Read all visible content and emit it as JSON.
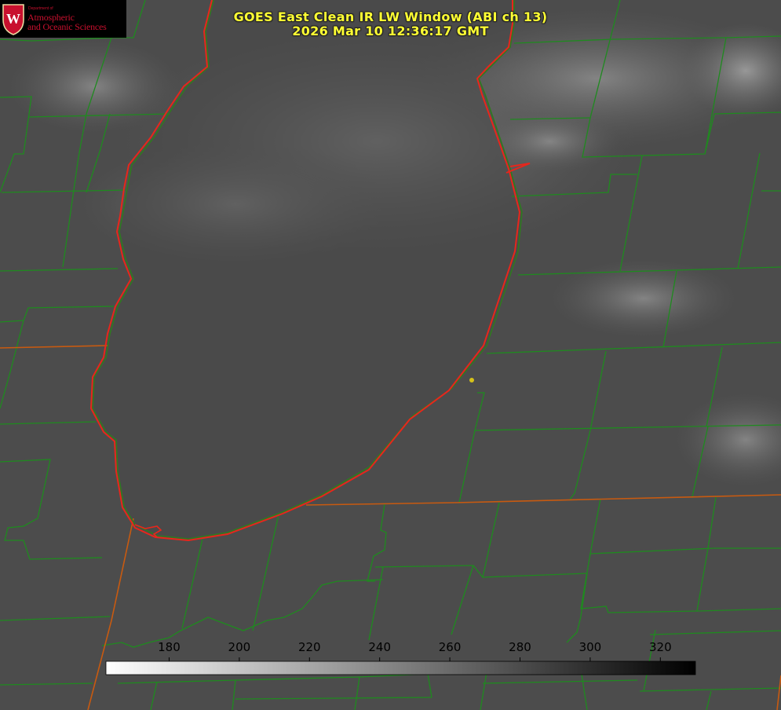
{
  "title": {
    "line1": "GOES East Clean IR LW Window (ABI ch 13)",
    "line2": "2026 Mar 10 12:36:17 GMT"
  },
  "logo": {
    "dept": "Department of",
    "line1": "Atmospheric",
    "line2": "and Oceanic Sciences",
    "crest_letter": "W",
    "color": "#c8102e"
  },
  "colorbar": {
    "ticks": [
      "180",
      "200",
      "220",
      "240",
      "260",
      "280",
      "300",
      "320"
    ],
    "values": [
      180,
      200,
      220,
      240,
      260,
      280,
      300,
      320
    ],
    "range": [
      162,
      330
    ],
    "gradient": [
      "#ffffff",
      "#000000"
    ]
  },
  "colors": {
    "lake_outline": "#e8261c",
    "boundary_green": "#1f8a1f",
    "state_line": "#c85a10",
    "marker": "#d6c21a",
    "title": "#ffff33"
  }
}
